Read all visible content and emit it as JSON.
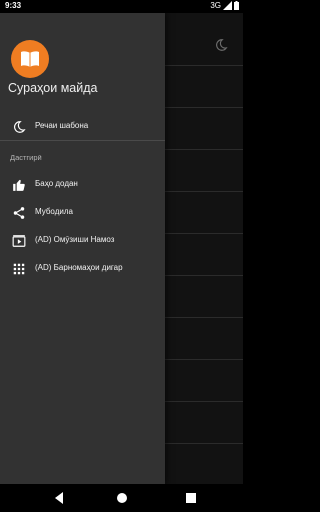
{
  "status_bar": {
    "time": "9:33",
    "network": "3G"
  },
  "app": {
    "title": "Сураҳои майда"
  },
  "drawer": {
    "theme_item": {
      "label": "Речаи шабона",
      "icon": "moon-icon"
    },
    "section_title": "Дастгирӣ",
    "items": [
      {
        "label": "Баҳо додан",
        "icon": "thumb-up-icon"
      },
      {
        "label": "Мубодила",
        "icon": "share-icon"
      },
      {
        "label": "(AD) Омӯзиши Намоз",
        "icon": "video-icon"
      },
      {
        "label": "(AD) Барномаҳои дигар",
        "icon": "apps-grid-icon"
      }
    ]
  },
  "colors": {
    "accent": "#ef7d22",
    "drawer_bg": "#323232",
    "background": "#121212"
  }
}
